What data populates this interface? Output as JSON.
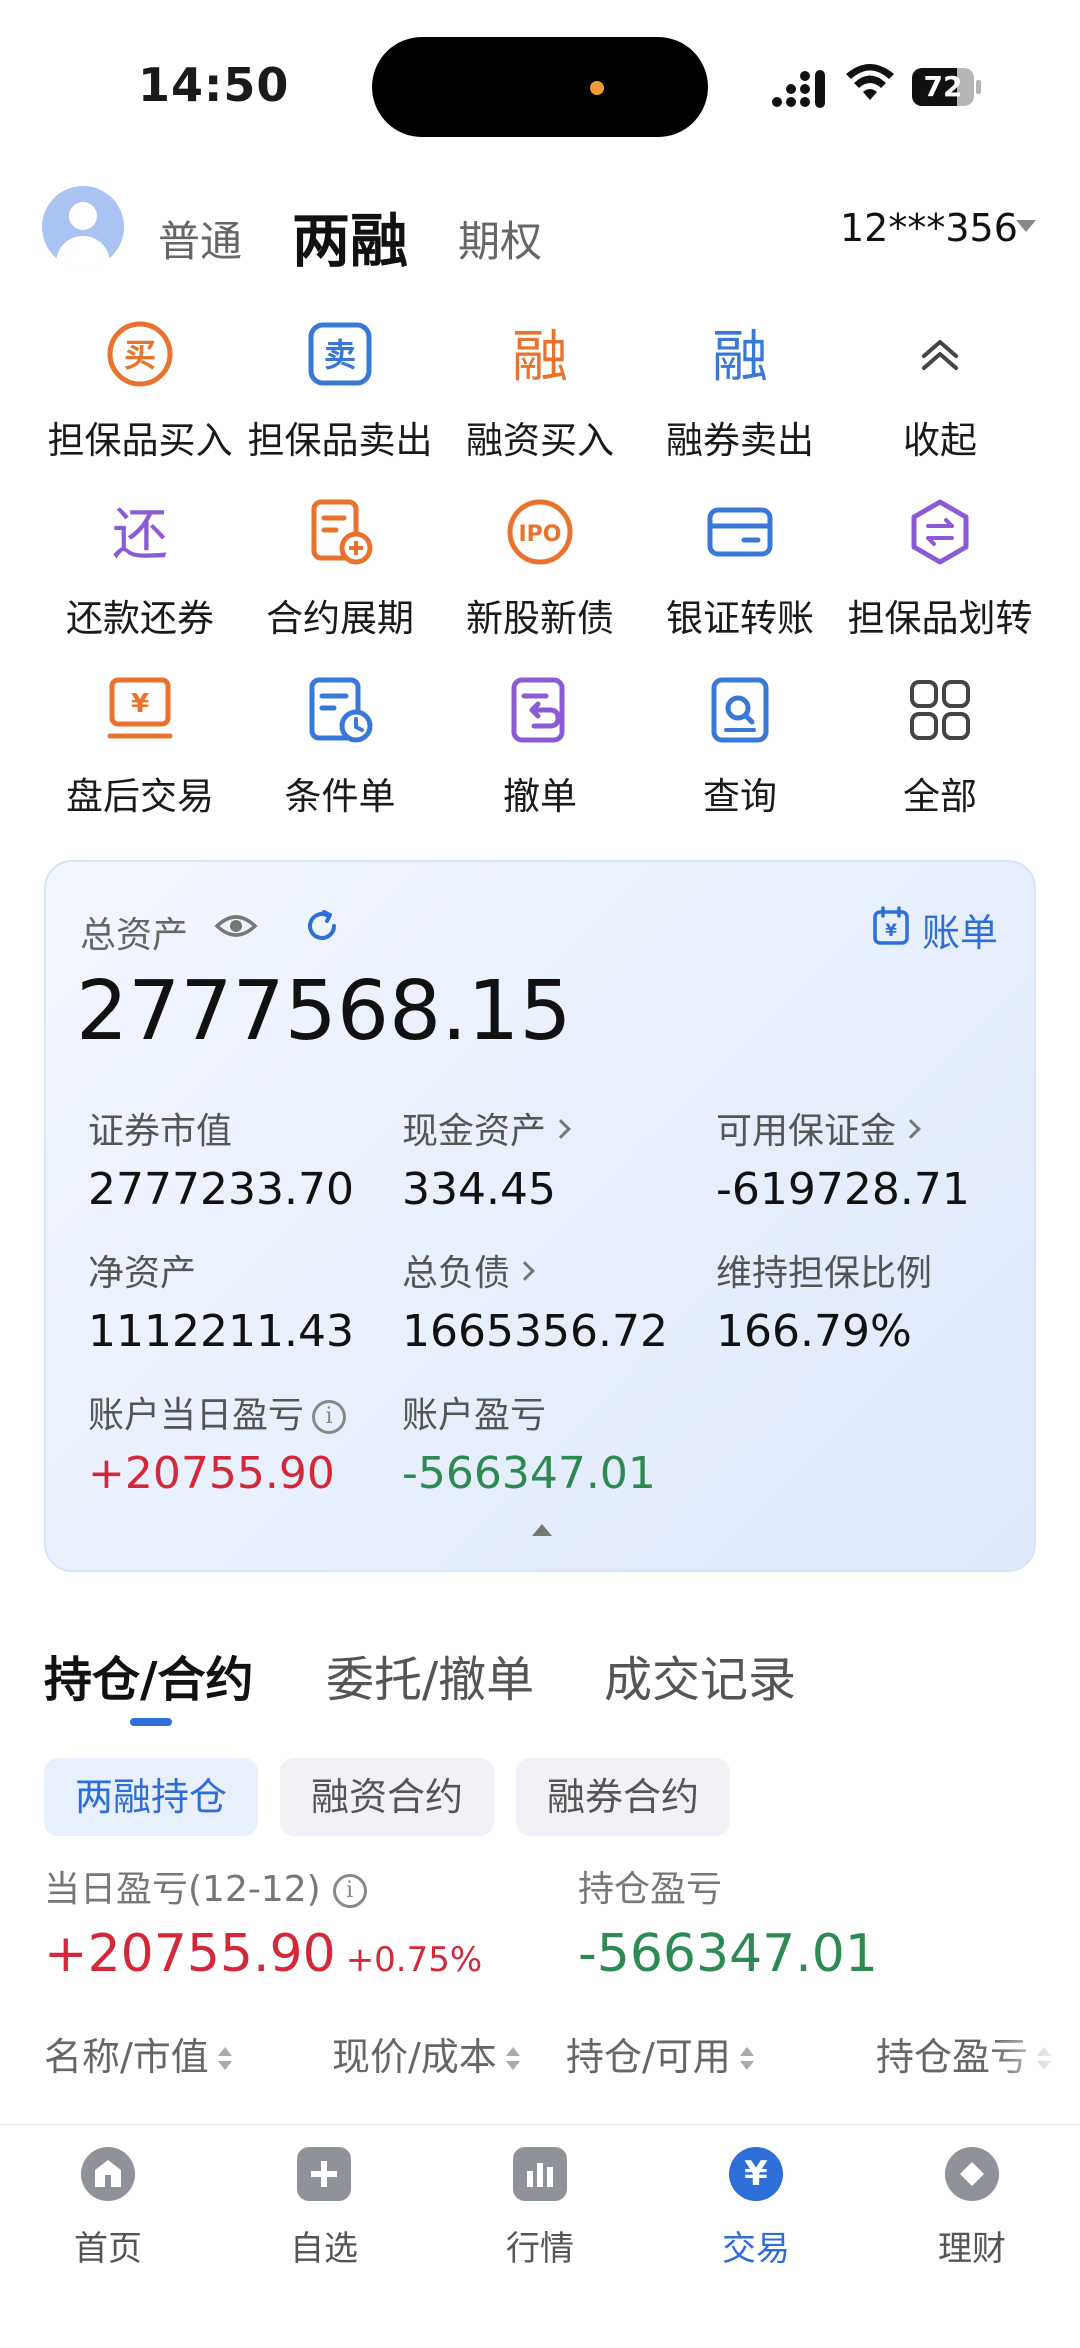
{
  "status": {
    "time": "14:50",
    "battery": "72",
    "battery_level": 0.72
  },
  "account": {
    "tabs": [
      "普通",
      "两融",
      "期权"
    ],
    "active_tab": "两融",
    "number": "12***356"
  },
  "functions": [
    {
      "label": "担保品买入",
      "icon": "buy-icon",
      "color": "#e9722e"
    },
    {
      "label": "担保品卖出",
      "icon": "sell-icon",
      "color": "#3a78d8"
    },
    {
      "label": "融资买入",
      "icon": "margin-buy-icon",
      "color": "#e9722e"
    },
    {
      "label": "融券卖出",
      "icon": "short-sell-icon",
      "color": "#3a78d8"
    },
    {
      "label": "收起",
      "icon": "chevron-up-icon",
      "color": "#444444"
    },
    {
      "label": "还款还券",
      "icon": "repay-icon",
      "color": "#8b5bd6"
    },
    {
      "label": "合约展期",
      "icon": "contract-extend-icon",
      "color": "#e9722e"
    },
    {
      "label": "新股新债",
      "icon": "ipo-icon",
      "color": "#e9722e"
    },
    {
      "label": "银证转账",
      "icon": "bank-transfer-icon",
      "color": "#3a78d8"
    },
    {
      "label": "担保品划转",
      "icon": "collateral-transfer-icon",
      "color": "#8b5bd6"
    },
    {
      "label": "盘后交易",
      "icon": "after-hours-icon",
      "color": "#e9722e"
    },
    {
      "label": "条件单",
      "icon": "conditional-order-icon",
      "color": "#3a78d8"
    },
    {
      "label": "撤单",
      "icon": "cancel-order-icon",
      "color": "#8b5bd6"
    },
    {
      "label": "查询",
      "icon": "query-icon",
      "color": "#3a78d8"
    },
    {
      "label": "全部",
      "icon": "all-apps-icon",
      "color": "#444444"
    }
  ],
  "assets": {
    "title": "总资产",
    "bill_label": "账单",
    "total": "2777568.15",
    "metrics": [
      {
        "label": "证券市值",
        "value": "2777233.70",
        "chevron": false
      },
      {
        "label": "现金资产",
        "value": "334.45",
        "chevron": true
      },
      {
        "label": "可用保证金",
        "value": "-619728.71",
        "chevron": true
      },
      {
        "label": "净资产",
        "value": "1112211.43",
        "chevron": false
      },
      {
        "label": "总负债",
        "value": "1665356.72",
        "chevron": true
      },
      {
        "label": "维持担保比例",
        "value": "166.79%",
        "chevron": false
      }
    ],
    "day_pl_label": "账户当日盈亏",
    "day_pl_value": "+20755.90",
    "acct_pl_label": "账户盈亏",
    "acct_pl_value": "-566347.01"
  },
  "tabs": [
    "持仓/合约",
    "委托/撤单",
    "成交记录"
  ],
  "chips": [
    "两融持仓",
    "融资合约",
    "融券合约"
  ],
  "pl": {
    "day_label": "当日盈亏(12-12)",
    "day_value": "+20755.90",
    "day_pct": "+0.75%",
    "hold_label": "持仓盈亏",
    "hold_value": "-566347.01"
  },
  "columns": [
    "名称/市值",
    "现价/成本",
    "持仓/可用",
    "持仓盈亏"
  ],
  "nav": [
    {
      "label": "首页",
      "icon": "home-icon"
    },
    {
      "label": "自选",
      "icon": "watchlist-icon"
    },
    {
      "label": "行情",
      "icon": "market-icon"
    },
    {
      "label": "交易",
      "icon": "trade-icon"
    },
    {
      "label": "理财",
      "icon": "wealth-icon"
    }
  ],
  "nav_active": "交易",
  "colors": {
    "accent": "#2e6ed9",
    "up": "#d3283a",
    "down": "#2c8a52"
  }
}
